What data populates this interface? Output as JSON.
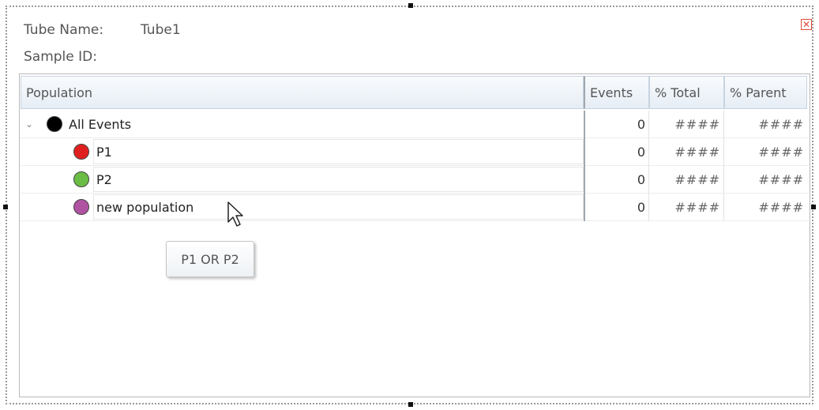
{
  "info": {
    "tube_name_label": "Tube Name:",
    "tube_name_value": "Tube1",
    "sample_id_label": "Sample ID:",
    "sample_id_value": ""
  },
  "window": {
    "close_icon": "close-icon"
  },
  "table": {
    "columns": [
      "Population",
      "Events",
      "% Total",
      "% Parent"
    ],
    "rows": [
      {
        "name": "All Events",
        "color": "#000000",
        "events": "0",
        "pct_total": "####",
        "pct_parent": "####",
        "expanded": true
      },
      {
        "name": "P1",
        "color": "#e0201f",
        "events": "0",
        "pct_total": "####",
        "pct_parent": "####"
      },
      {
        "name": "P2",
        "color": "#6cbd45",
        "events": "0",
        "pct_total": "####",
        "pct_parent": "####"
      },
      {
        "name": "new population",
        "color": "#b153a3",
        "events": "0",
        "pct_total": "####",
        "pct_parent": "####"
      }
    ]
  },
  "tooltip": {
    "text": "P1 OR P2"
  },
  "colors": {
    "accent_red": "#e04b3a",
    "header_border": "#c7d3e0"
  }
}
